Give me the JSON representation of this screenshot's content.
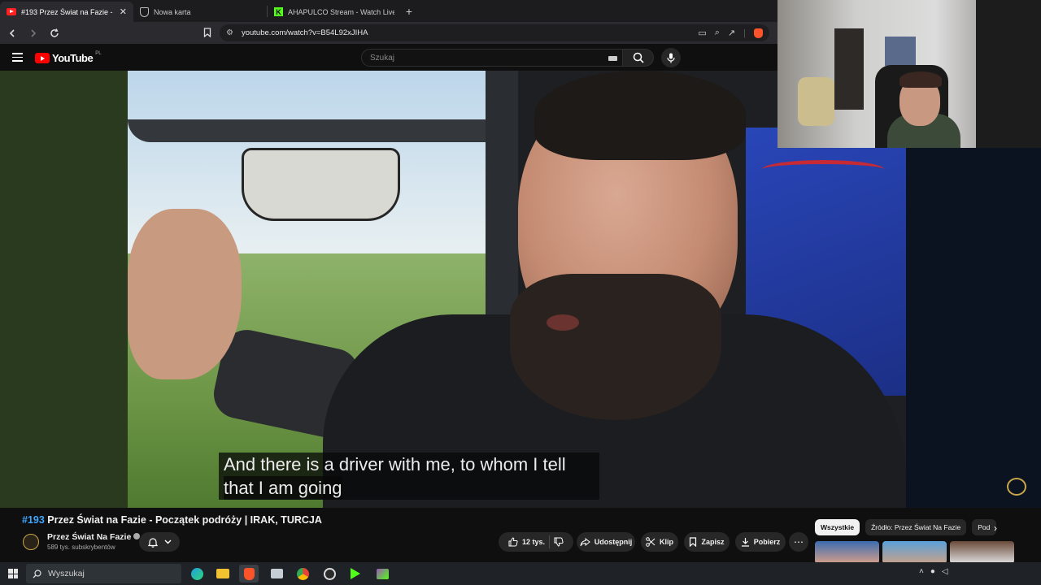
{
  "browser": {
    "tabs": [
      {
        "title": "#193 Przez Świat na Fazie - P",
        "active": true,
        "favicon": "youtube-icon"
      },
      {
        "title": "Nowa karta",
        "active": false,
        "favicon": "shield-icon"
      },
      {
        "title": "AHAPULCO Stream - Watch Live on K",
        "active": false,
        "favicon": "kick-icon"
      }
    ],
    "url": "youtube.com/watch?v=B54L92xJIHA"
  },
  "youtube": {
    "region": "PL",
    "logo_text": "YouTube",
    "search_placeholder": "Szukaj"
  },
  "video": {
    "caption_line1": "And there is a driver with me, to whom I tell",
    "caption_line2": "that I am going",
    "title_hash": "#193",
    "title_rest": " Przez Świat na Fazie - Początek podróży | IRAK, TURCJA",
    "channel_name": "Przez Świat Na Fazie",
    "subscribers": "589 tys. subskrybentów",
    "likes": "12 tys.",
    "share_label": "Udostępnij",
    "clip_label": "Klip",
    "save_label": "Zapisz",
    "download_label": "Pobierz"
  },
  "chips": [
    "Wszystkie",
    "Źródło: Przez Świat Na Fazie",
    "Pod"
  ],
  "taskbar": {
    "search_placeholder": "Wyszukaj"
  },
  "colors": {
    "accent_link": "#3ea6ff",
    "youtube_red": "#ff0000",
    "background": "#0f0f0f"
  }
}
